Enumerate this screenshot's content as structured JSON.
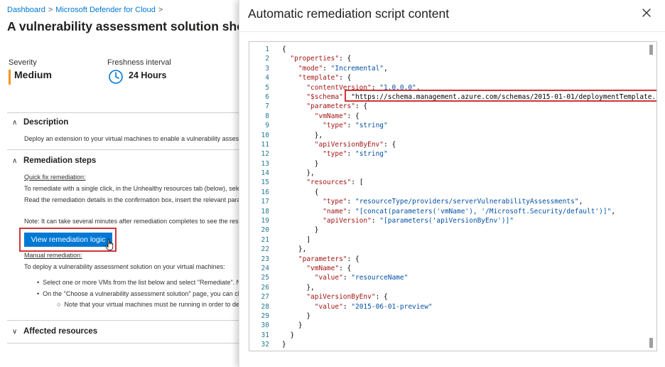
{
  "breadcrumb": {
    "items": [
      "Dashboard",
      "Microsoft Defender for Cloud"
    ],
    "separator": ">"
  },
  "page_title": "A vulnerability assessment solution should",
  "severity": {
    "label": "Severity",
    "value": "Medium",
    "color": "#f7941d"
  },
  "freshness": {
    "label": "Freshness interval",
    "value": "24 Hours"
  },
  "description": {
    "heading": "Description",
    "text": "Deploy an extension to your virtual machines to enable a vulnerability assessment"
  },
  "remediation": {
    "heading": "Remediation steps",
    "quick_fix_label": "Quick fix remediation:",
    "line1": "To remediate with a single click, in the Unhealthy resources tab (below), select the",
    "line2": "Read the remediation details in the confirmation box, insert the relevant paramete",
    "note": "Note: It can take several minutes after remediation completes to see the resources",
    "button_label": "View remediation logic",
    "manual_label": "Manual remediation:",
    "manual_text": "To deploy a vulnerability assessment solution on your virtual machines:",
    "bullet1": "Select one or more VMs from the list below and select \"Remediate\". Note:",
    "bullet2": "On the \"Choose a vulnerability assessment solution\" page, you can choos",
    "bullet3": "Note that your virtual machines must be running in order to deplo"
  },
  "affected": {
    "heading": "Affected resources"
  },
  "panel": {
    "title": "Automatic remediation script content",
    "close_label": "×",
    "code_lines": [
      "{",
      "  \"properties\": {",
      "    \"mode\": \"Incremental\",",
      "    \"template\": {",
      "      \"contentVersion\": \"1.0.0.0\",",
      "      \"$schema\": \"https://schema.management.azure.com/schemas/2015-01-01/deploymentTemplate.j",
      "      \"parameters\": {",
      "        \"vmName\": {",
      "          \"type\": \"string\"",
      "        },",
      "        \"apiVersionByEnv\": {",
      "          \"type\": \"string\"",
      "        }",
      "      },",
      "      \"resources\": [",
      "        {",
      "          \"type\": \"resourceType/providers/serverVulnerabilityAssessments\",",
      "          \"name\": \"[concat(parameters('vmName'), '/Microsoft.Security/default')]\",",
      "          \"apiVersion\": \"[parameters('apiVersionByEnv')]\"",
      "        }",
      "      ]",
      "    },",
      "    \"parameters\": {",
      "      \"vmName\": {",
      "        \"value\": \"resourceName\"",
      "      },",
      "      \"apiVersionByEnv\": {",
      "        \"value\": \"2015-06-01-preview\"",
      "      }",
      "    }",
      "  }",
      "}"
    ]
  }
}
